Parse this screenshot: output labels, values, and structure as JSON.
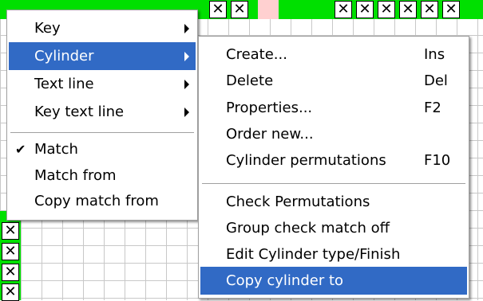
{
  "colors": {
    "highlight": "#316ac5",
    "menu_bg": "#ffffff",
    "grid_green": "#00e000",
    "grid_pink": "#ffd0d0"
  },
  "grid": {
    "top_marks": [
      "✕",
      "✕",
      "✕",
      "✕",
      "✕",
      "✕",
      "✕",
      "✕"
    ],
    "left_marks": [
      "✕",
      "✕",
      "✕",
      "✕"
    ]
  },
  "main_menu": {
    "items": [
      {
        "label": "Key",
        "submenu": true
      },
      {
        "label": "Cylinder",
        "submenu": true,
        "highlighted": true
      },
      {
        "label": "Text line",
        "submenu": true
      },
      {
        "label": "Key text line",
        "submenu": true
      },
      {
        "label": "Match",
        "checked": true,
        "check_glyph": "✔"
      },
      {
        "label": "Match from"
      },
      {
        "label": "Copy match from"
      }
    ]
  },
  "cylinder_menu": {
    "items": [
      {
        "label": "Create...",
        "shortcut": "Ins"
      },
      {
        "label": "Delete",
        "shortcut": "Del"
      },
      {
        "label": "Properties...",
        "shortcut": "F2"
      },
      {
        "label": "Order new..."
      },
      {
        "label": "Cylinder permutations",
        "shortcut": "F10"
      },
      {
        "label": "Check Permutations"
      },
      {
        "label": "Group check match off"
      },
      {
        "label": "Edit Cylinder type/Finish"
      },
      {
        "label": "Copy cylinder to",
        "highlighted": true
      }
    ]
  }
}
